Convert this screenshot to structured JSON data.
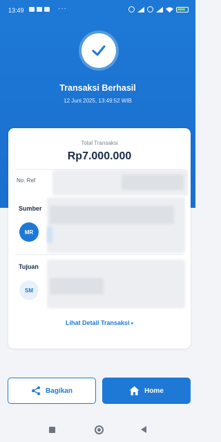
{
  "status_bar": {
    "time": "13:49",
    "dots": "···"
  },
  "header": {
    "title": "Transaksi Berhasil",
    "datetime": "12 Juni 2025, 13:49:52 WIB"
  },
  "card": {
    "total_label": "Total Transaksi",
    "total_amount": "Rp7.000.000",
    "ref_label": "No. Ref",
    "source_label": "Sumber",
    "source_initials": "MR",
    "destination_label": "Tujuan",
    "destination_initials": "SM",
    "detail_link": "Lihat Detail Transaksi",
    "detail_chevron": "▾"
  },
  "actions": {
    "share_label": "Bagikan",
    "home_label": "Home"
  },
  "colors": {
    "primary": "#1e79d6",
    "background": "#f2f4f8",
    "text_dark": "#1b2a4a"
  }
}
